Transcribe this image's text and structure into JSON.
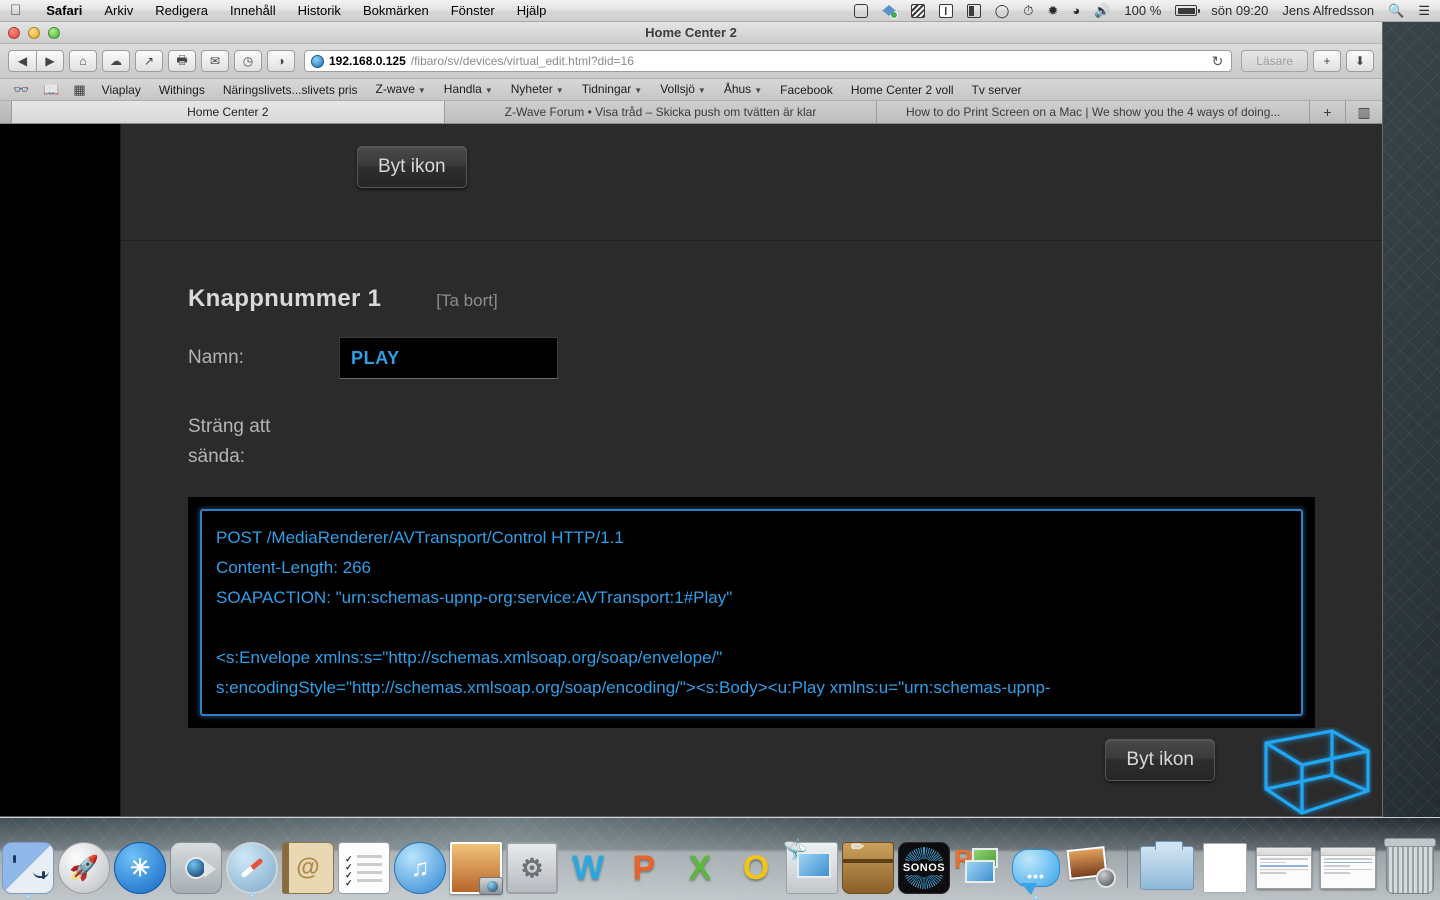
{
  "menubar": {
    "apple": "",
    "items": [
      {
        "label": "Safari",
        "bold": true
      },
      {
        "label": "Arkiv",
        "bold": false
      },
      {
        "label": "Redigera",
        "bold": false
      },
      {
        "label": "Innehåll",
        "bold": false
      },
      {
        "label": "Historik",
        "bold": false
      },
      {
        "label": "Bokmärken",
        "bold": false
      },
      {
        "label": "Fönster",
        "bold": false
      },
      {
        "label": "Hjälp",
        "bold": false
      }
    ],
    "status": {
      "battery_percent": "100 %",
      "datetime": "sön 09:20",
      "user": "Jens Alfredsson",
      "search_icon": "search-icon",
      "notification_icon": "notification-center-icon",
      "icons": [
        "1password-icon",
        "dropbox-icon",
        "hazel-icon",
        "istat-icon",
        "displays-icon",
        "messages-status-icon",
        "timemachine-icon",
        "bluetooth-icon",
        "wifi-icon",
        "volume-icon"
      ]
    }
  },
  "window": {
    "title": "Home Center 2"
  },
  "toolbar": {
    "back": "◀",
    "forward": "▶",
    "home": "⌂",
    "cloud": "☁",
    "share": "↗",
    "print": "🖶",
    "mail": "✉",
    "history": "◷",
    "private": "◑",
    "url_host": "192.168.0.125",
    "url_path": "/fibaro/sv/devices/virtual_edit.html?did=16",
    "reload": "↻",
    "reader_label": "Läsare",
    "add_tab": "+",
    "downloads": "⬇"
  },
  "bookmarks": {
    "icons": [
      "reading-glasses-icon",
      "book-icon",
      "top-sites-icon"
    ],
    "items": [
      {
        "label": "Viaplay",
        "menu": false
      },
      {
        "label": "Withings",
        "menu": false
      },
      {
        "label": "Näringslivets...slivets pris",
        "menu": false
      },
      {
        "label": "Z-wave",
        "menu": true
      },
      {
        "label": "Handla",
        "menu": true
      },
      {
        "label": "Nyheter",
        "menu": true
      },
      {
        "label": "Tidningar",
        "menu": true
      },
      {
        "label": "Vollsjö",
        "menu": true
      },
      {
        "label": "Åhus",
        "menu": true
      },
      {
        "label": "Facebook",
        "menu": false
      },
      {
        "label": "Home Center 2 voll",
        "menu": false
      },
      {
        "label": "Tv server",
        "menu": false
      }
    ]
  },
  "tabs": {
    "items": [
      {
        "label": "Home Center 2",
        "active": true
      },
      {
        "label": "Z-Wave Forum • Visa tråd – Skicka push om tvätten är klar",
        "active": false
      },
      {
        "label": "How to do Print Screen on a Mac | We show you the 4 ways of doing...",
        "active": false
      }
    ],
    "new_tab": "+",
    "tab_overview": "▥"
  },
  "page": {
    "change_icon_top_label": "Byt ikon",
    "change_icon_bottom_label": "Byt ikon",
    "button_title": "Knappnummer 1",
    "remove_label": "[Ta bort]",
    "name_label": "Namn:",
    "name_value": "PLAY",
    "string_label": "Sträng att sända:",
    "string_value": "POST /MediaRenderer/AVTransport/Control HTTP/1.1\nContent-Length: 266\nSOAPACTION: \"urn:schemas-upnp-org:service:AVTransport:1#Play\"\n\n<s:Envelope xmlns:s=\"http://schemas.xmlsoap.org/soap/envelope/\"\ns:encodingStyle=\"http://schemas.xmlsoap.org/soap/encoding/\"><s:Body><u:Play xmlns:u=\"urn:schemas-upnp-",
    "logo": "fibaro-cube-logo",
    "accent_color": "#2f9fe8",
    "focus_border_color": "#2f7fc4",
    "page_background": "#2b2b2b"
  },
  "dock": {
    "items": [
      {
        "name": "finder",
        "label": "Finder"
      },
      {
        "name": "launchpad",
        "label": "Launchpad"
      },
      {
        "name": "app-store",
        "label": "App Store"
      },
      {
        "name": "facetime",
        "label": "FaceTime"
      },
      {
        "name": "safari",
        "label": "Safari"
      },
      {
        "name": "contacts",
        "label": "Kontakter"
      },
      {
        "name": "reminders",
        "label": "Påminnelser"
      },
      {
        "name": "itunes",
        "label": "iTunes"
      },
      {
        "name": "iphoto",
        "label": "iPhoto"
      },
      {
        "name": "system-preferences",
        "label": "Systeminställningar"
      },
      {
        "name": "word",
        "label": "W"
      },
      {
        "name": "powerpoint",
        "label": "P"
      },
      {
        "name": "excel",
        "label": "X"
      },
      {
        "name": "outlook",
        "label": "O"
      },
      {
        "name": "remote-desktop",
        "label": "Remote Desktop"
      },
      {
        "name": "bucket-utility",
        "label": "Verktyg"
      },
      {
        "name": "sonos",
        "label": "SONOS"
      },
      {
        "name": "screen-sharing",
        "label": "R"
      },
      {
        "name": "messages",
        "label": "Meddelanden"
      },
      {
        "name": "photo-booth",
        "label": "Photo Booth"
      },
      {
        "name": "separator",
        "label": ""
      },
      {
        "name": "downloads-folder",
        "label": "Hämtade filer"
      },
      {
        "name": "document-window",
        "label": "Dokument"
      },
      {
        "name": "minimized-window-1",
        "label": "Fönster"
      },
      {
        "name": "minimized-window-2",
        "label": "Fönster"
      },
      {
        "name": "trash",
        "label": "Papperskorg"
      }
    ]
  }
}
